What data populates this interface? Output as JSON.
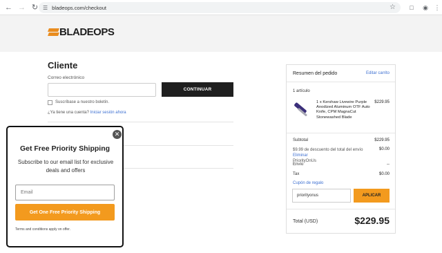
{
  "browser": {
    "url": "bladeops.com/checkout"
  },
  "header": {
    "logo_prefix": "BLADE",
    "logo_suffix": "OPS",
    "logo_color": "#e98c1f"
  },
  "customer": {
    "title": "Cliente",
    "email_label": "Correo electrónico",
    "email_value": "",
    "continue_label": "CONTINUAR",
    "newsletter_label": "Suscríbase a nuestro boletín.",
    "account_prompt": "¿Ya tiene una cuenta?",
    "login_link": "Iniciar sesión ahora"
  },
  "summary": {
    "title": "Resumen del pedido",
    "edit_link": "Editar carrito",
    "item_count": "1 artículo",
    "product": {
      "description": "1 x Kershaw Livewire Purple Anodized Aluminum OTF Auto Knife, CPM MagnaCut Stonewashed Blade",
      "price": "$229.95"
    },
    "subtotal_label": "Subtotal",
    "subtotal_value": "$229.95",
    "discount_text": "$9.99 de descuento del total del envío",
    "discount_remove": "Eliminar",
    "discount_code": "PriorityOnUs",
    "discount_value": "$0.00",
    "shipping_label": "Envío",
    "shipping_value": "--",
    "tax_label": "Tax",
    "tax_value": "$0.00",
    "coupon_link": "Cupón de regalo",
    "coupon_value": "priorityonus",
    "apply_label": "APLICAR",
    "total_label": "Total (USD)",
    "total_value": "$229.95",
    "accent_color": "#f39a1e"
  },
  "popup": {
    "close_icon": "close-icon",
    "title": "Get Free Priority Shipping",
    "subtitle": "Subscribe to our email list for exclusive deals and offers",
    "email_placeholder": "Email",
    "cta_label": "Get One Free Priority Shipping",
    "terms": "Terms and conditions apply on offer."
  }
}
